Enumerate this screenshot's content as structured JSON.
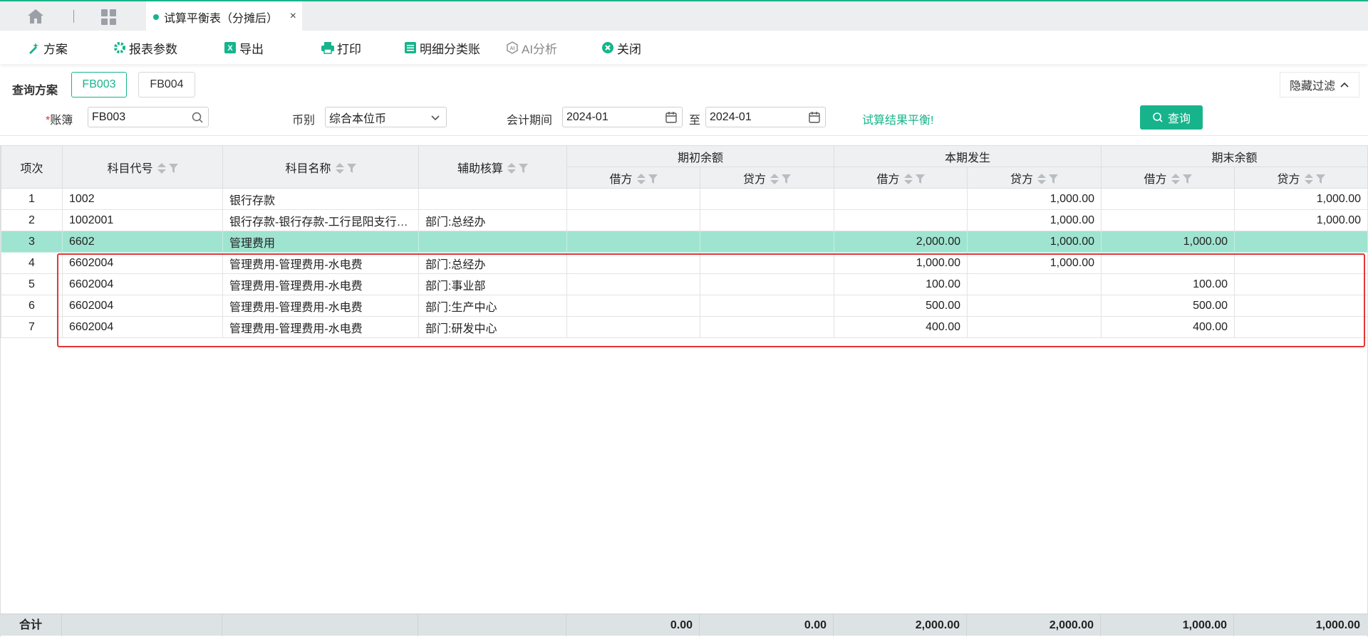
{
  "tabs": {
    "active_label": "试算平衡表（分摊后）",
    "close": "×"
  },
  "toolbar": {
    "scheme": "方案",
    "params": "报表参数",
    "export": "导出",
    "print": "打印",
    "ledger": "明细分类账",
    "ai": "AI分析",
    "close": "关闭"
  },
  "filters": {
    "scheme_label": "查询方案",
    "schemes": [
      "FB003",
      "FB004"
    ],
    "hide_filter": "隐藏过滤",
    "book_label": "账簿",
    "book_value": "FB003",
    "currency_label": "币别",
    "currency_value": "综合本位币",
    "period_label": "会计期间",
    "period_from": "2024-01",
    "period_to_sep": "至",
    "period_to": "2024-01",
    "balance_message": "试算结果平衡!",
    "query_button": "查询"
  },
  "table": {
    "headers": {
      "idx": "项次",
      "code": "科目代号",
      "name": "科目名称",
      "aux": "辅助核算",
      "opening": "期初余额",
      "current": "本期发生",
      "closing": "期末余额",
      "debit": "借方",
      "credit": "贷方"
    },
    "rows": [
      {
        "idx": "1",
        "code": "1002",
        "name": "银行存款",
        "aux": "",
        "od": "",
        "oc": "",
        "cd": "",
        "cc": "1,000.00",
        "ed": "",
        "ec": "1,000.00"
      },
      {
        "idx": "2",
        "code": "1002001",
        "name": "银行存款-银行存款-工行昆阳支行…",
        "aux": "部门:总经办",
        "od": "",
        "oc": "",
        "cd": "",
        "cc": "1,000.00",
        "ed": "",
        "ec": "1,000.00"
      },
      {
        "idx": "3",
        "code": "6602",
        "name": "管理费用",
        "aux": "",
        "od": "",
        "oc": "",
        "cd": "2,000.00",
        "cc": "1,000.00",
        "ed": "1,000.00",
        "ec": ""
      },
      {
        "idx": "4",
        "code": "6602004",
        "name": "管理费用-管理费用-水电费",
        "aux": "部门:总经办",
        "od": "",
        "oc": "",
        "cd": "1,000.00",
        "cc": "1,000.00",
        "ed": "",
        "ec": ""
      },
      {
        "idx": "5",
        "code": "6602004",
        "name": "管理费用-管理费用-水电费",
        "aux": "部门:事业部",
        "od": "",
        "oc": "",
        "cd": "100.00",
        "cc": "",
        "ed": "100.00",
        "ec": ""
      },
      {
        "idx": "6",
        "code": "6602004",
        "name": "管理费用-管理费用-水电费",
        "aux": "部门:生产中心",
        "od": "",
        "oc": "",
        "cd": "500.00",
        "cc": "",
        "ed": "500.00",
        "ec": ""
      },
      {
        "idx": "7",
        "code": "6602004",
        "name": "管理费用-管理费用-水电费",
        "aux": "部门:研发中心",
        "od": "",
        "oc": "",
        "cd": "400.00",
        "cc": "",
        "ed": "400.00",
        "ec": ""
      }
    ],
    "totals": {
      "label": "合计",
      "od": "0.00",
      "oc": "0.00",
      "cd": "2,000.00",
      "cc": "2,000.00",
      "ed": "1,000.00",
      "ec": "1,000.00"
    }
  },
  "colors": {
    "accent": "#17b48c",
    "selected_row": "#9fe4d0",
    "highlight_border": "#e53535"
  }
}
